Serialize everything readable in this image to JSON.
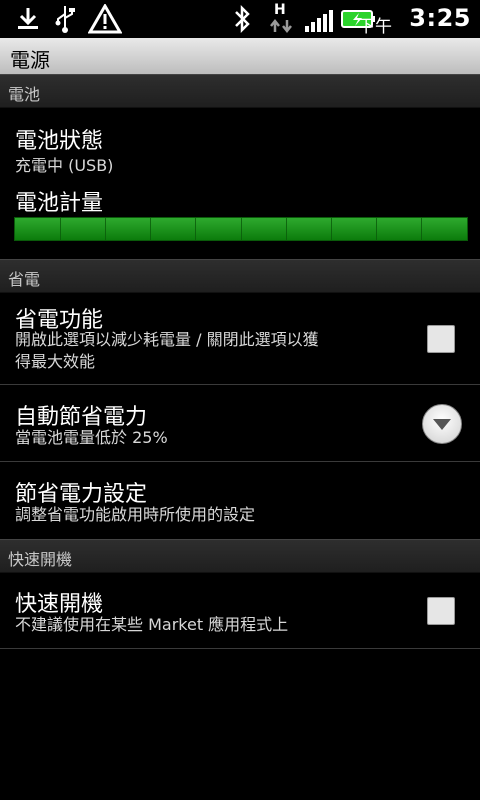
{
  "status_bar": {
    "ampm": "下午",
    "time": "3:25",
    "network": "H"
  },
  "title_bar": {
    "title": "電源"
  },
  "sections": {
    "battery": {
      "header": "電池"
    },
    "power_saving": {
      "header": "省電"
    },
    "fast_boot": {
      "header": "快速開機"
    }
  },
  "items": {
    "battery_status": {
      "title": "電池狀態",
      "summary": "充電中 (USB)"
    },
    "battery_meter": {
      "title": "電池計量",
      "level_percent": 100
    },
    "power_saver": {
      "title": "省電功能",
      "summary_line1": "開啟此選項以減少耗電量 / 關閉此選項以獲",
      "summary_line2": "得最大效能",
      "checked": false
    },
    "auto_save": {
      "title": "自動節省電力",
      "summary": "當電池電量低於 25%"
    },
    "save_settings": {
      "title": "節省電力設定",
      "summary": "調整省電功能啟用時所使用的設定"
    },
    "fast_boot": {
      "title": "快速開機",
      "summary": "不建議使用在某些 Market 應用程式上",
      "checked": false
    }
  },
  "colors": {
    "battery_green": "#1f9a1f",
    "charging_accent": "#2bd32b"
  },
  "icons": [
    "download-icon",
    "usb-icon",
    "warning-icon",
    "bluetooth-icon",
    "data-arrows-icon",
    "signal-icon",
    "battery-charging-icon"
  ]
}
